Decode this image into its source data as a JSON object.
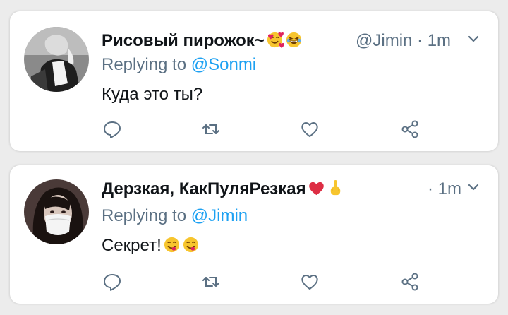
{
  "tweets": [
    {
      "name": "Рисовый пирожок~",
      "handle_time": "@Jimin · 1m",
      "replying_prefix": "Replying to",
      "replying_to": "@Sonmi",
      "text": "Куда это ты?",
      "emojis": [
        "smiling-face-with-hearts-emoji",
        "laughing-face-emoji"
      ]
    },
    {
      "name": "Дерзкая, КакПуляРезкая",
      "handle_time": "· 1m",
      "replying_prefix": "Replying to",
      "replying_to": "@Jimin",
      "text": "Секрет!",
      "emojis": [
        "red-heart-emoji",
        "middle-finger-emoji",
        "face-savoring-food-emoji",
        "face-savoring-food-emoji"
      ]
    }
  ],
  "colors": {
    "name": "#101418",
    "muted": "#5b7083",
    "mention": "#1da1f2",
    "icon": "#5b7083"
  }
}
